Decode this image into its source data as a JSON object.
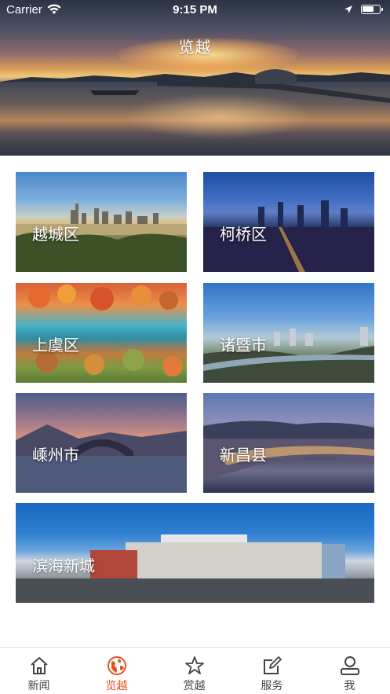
{
  "status_bar": {
    "carrier": "Carrier",
    "time": "9:15 PM"
  },
  "header": {
    "title": "览越"
  },
  "districts": [
    {
      "label": "越城区"
    },
    {
      "label": "柯桥区"
    },
    {
      "label": "上虞区"
    },
    {
      "label": "诸暨市"
    },
    {
      "label": "嵊州市"
    },
    {
      "label": "新昌县"
    },
    {
      "label": "滨海新城"
    }
  ],
  "tabbar": {
    "active_color": "#e2531f",
    "items": [
      {
        "label": "新闻",
        "icon": "home-icon"
      },
      {
        "label": "览越",
        "icon": "globe-icon",
        "active": true
      },
      {
        "label": "赏越",
        "icon": "star-icon"
      },
      {
        "label": "服务",
        "icon": "edit-icon"
      },
      {
        "label": "我",
        "icon": "user-icon"
      }
    ]
  }
}
